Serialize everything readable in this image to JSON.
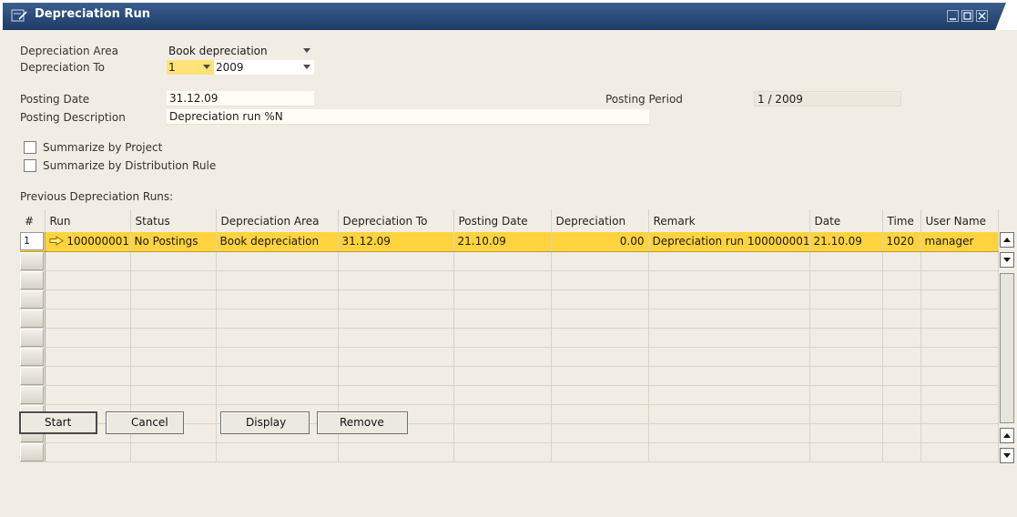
{
  "window": {
    "title": "Depreciation Run"
  },
  "form": {
    "depreciation_area_label": "Depreciation Area",
    "depreciation_area_value": "Book depreciation",
    "depreciation_to_label": "Depreciation To",
    "depreciation_to_period": "1",
    "depreciation_to_year": "2009",
    "posting_date_label": "Posting Date",
    "posting_date_value": "31.12.09",
    "posting_period_label": "Posting Period",
    "posting_period_value": "1 / 2009",
    "posting_description_label": "Posting Description",
    "posting_description_value": "Depreciation run %N",
    "summarize_project_label": "Summarize by Project",
    "summarize_rule_label": "Summarize by Distribution Rule"
  },
  "grid": {
    "caption": "Previous Depreciation Runs:",
    "columns": [
      "#",
      "Run",
      "Status",
      "Depreciation Area",
      "Depreciation To",
      "Posting Date",
      "Depreciation",
      "Remark",
      "Date",
      "Time",
      "User Name"
    ],
    "rows": [
      {
        "num": "1",
        "run": "100000001",
        "status": "No Postings",
        "area": "Book depreciation",
        "dep_to": "31.12.09",
        "posting_date": "21.10.09",
        "depreciation": "0.00",
        "remark": "Depreciation run 100000001",
        "date": "21.10.09",
        "time": "1020",
        "user": "manager"
      }
    ]
  },
  "buttons": {
    "start": "Start",
    "cancel": "Cancel",
    "display": "Display",
    "remove": "Remove"
  },
  "colors": {
    "title_bar": "#2a4a78",
    "selected_row": "#ffd33d",
    "form_background": "#f1ede4"
  }
}
